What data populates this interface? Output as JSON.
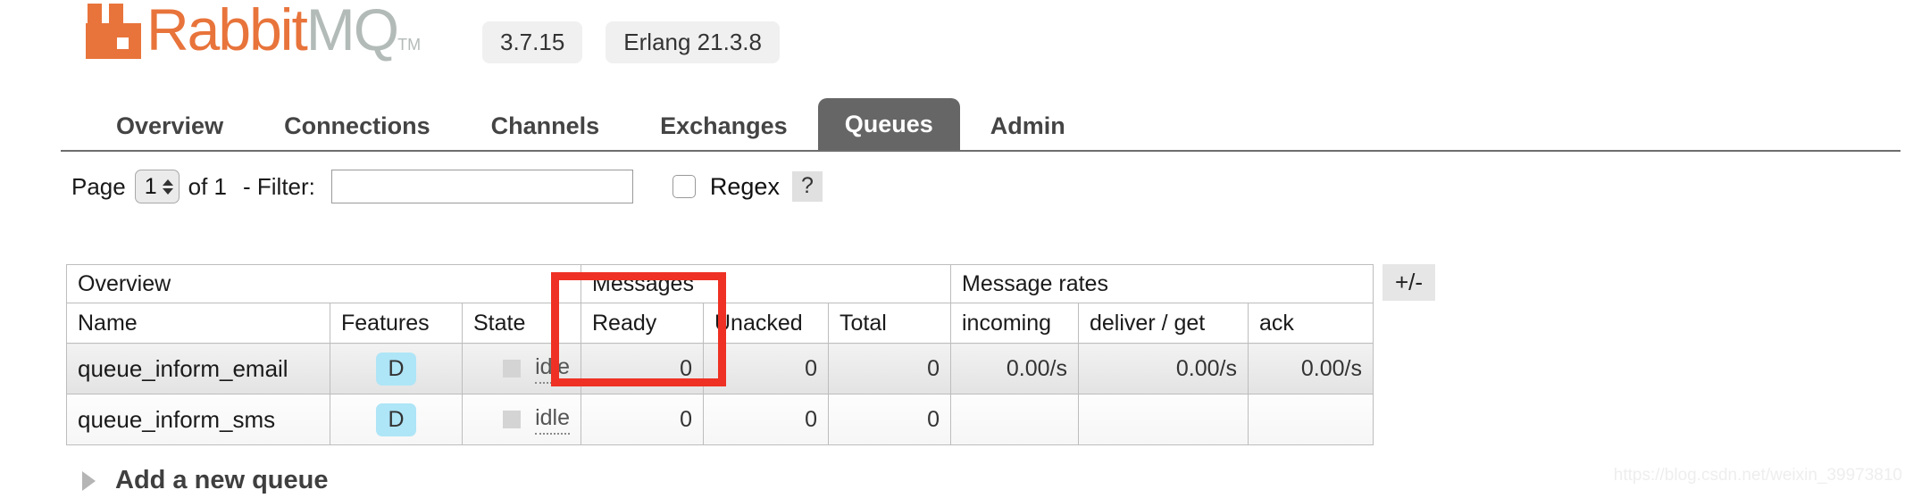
{
  "brand": {
    "name_rabbit": "Rabbit",
    "name_mq": "MQ",
    "trademark": "TM",
    "logo_icon": "rabbitmq-logo-icon",
    "accent_color": "#e8743b",
    "mq_color": "#b3bbb8"
  },
  "header": {
    "version_badge": "3.7.15",
    "erlang_badge": "Erlang 21.3.8"
  },
  "nav": {
    "tabs": [
      {
        "label": "Overview",
        "active": false
      },
      {
        "label": "Connections",
        "active": false
      },
      {
        "label": "Channels",
        "active": false
      },
      {
        "label": "Exchanges",
        "active": false
      },
      {
        "label": "Queues",
        "active": true
      },
      {
        "label": "Admin",
        "active": false
      }
    ]
  },
  "filter_bar": {
    "page_label": "Page",
    "page_value": "1",
    "of_label": "of 1",
    "dash_filter_label": "- Filter:",
    "filter_value": "",
    "filter_placeholder": "",
    "regex_label": "Regex",
    "regex_checked": false,
    "help_label": "?"
  },
  "table": {
    "group_headers": [
      {
        "label": "Overview",
        "span": 3
      },
      {
        "label": "Messages",
        "span": 3
      },
      {
        "label": "Message rates",
        "span": 3
      }
    ],
    "columns": [
      {
        "label": "Name",
        "align": "left"
      },
      {
        "label": "Features",
        "align": "left"
      },
      {
        "label": "State",
        "align": "left"
      },
      {
        "label": "Ready",
        "align": "left"
      },
      {
        "label": "Unacked",
        "align": "left"
      },
      {
        "label": "Total",
        "align": "left"
      },
      {
        "label": "incoming",
        "align": "left"
      },
      {
        "label": "deliver / get",
        "align": "left"
      },
      {
        "label": "ack",
        "align": "left"
      }
    ],
    "rows": [
      {
        "name": "queue_inform_email",
        "feature": "D",
        "state": "idle",
        "ready": "0",
        "unacked": "0",
        "total": "0",
        "incoming": "0.00/s",
        "deliver_get": "0.00/s",
        "ack": "0.00/s"
      },
      {
        "name": "queue_inform_sms",
        "feature": "D",
        "state": "idle",
        "ready": "0",
        "unacked": "0",
        "total": "0",
        "incoming": "",
        "deliver_get": "",
        "ack": ""
      }
    ],
    "toggle_columns_label": "+/-"
  },
  "footer": {
    "add_queue_label": "Add a new queue",
    "watermark": "https://blog.csdn.net/weixin_39973810"
  },
  "annotation": {
    "color": "#ee3124",
    "target": "ready-column-highlight"
  }
}
